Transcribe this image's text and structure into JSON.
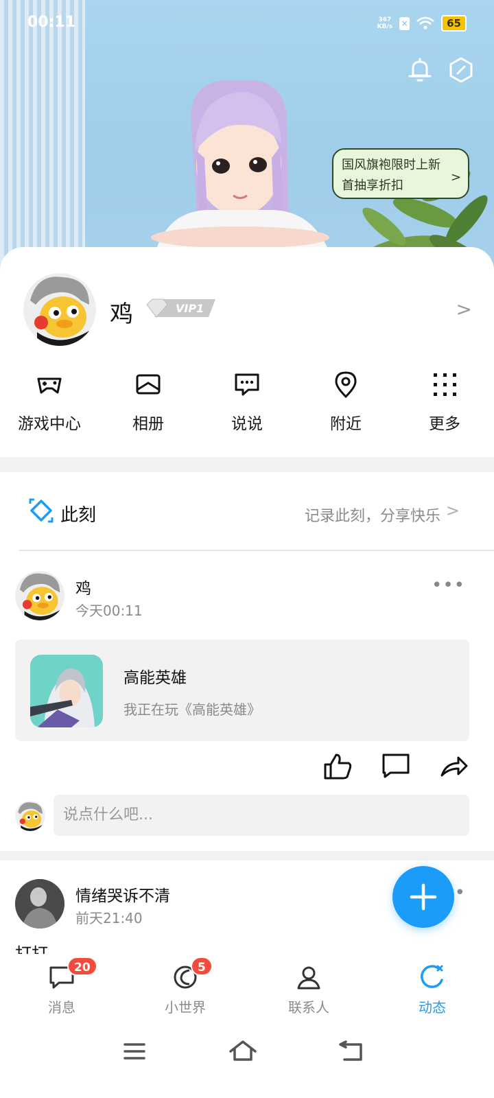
{
  "status_bar": {
    "time": "00:11",
    "net_speed_value": "367",
    "net_speed_unit": "KB/s",
    "sim_glyph": "×",
    "battery": "65"
  },
  "hero": {
    "promo_line1": "国风旗袍限时上新",
    "promo_line2": "首抽享折扣",
    "icons": [
      "bell-icon",
      "settings-hexagon-icon"
    ]
  },
  "profile": {
    "name": "鸡",
    "vip_label": "VIP1"
  },
  "quick_actions": [
    {
      "label": "游戏中心",
      "icon": "gamepad-icon"
    },
    {
      "label": "相册",
      "icon": "album-icon"
    },
    {
      "label": "说说",
      "icon": "message-bubble-icon"
    },
    {
      "label": "附近",
      "icon": "location-pin-icon"
    },
    {
      "label": "更多",
      "icon": "grid-dots-icon"
    }
  ],
  "moment": {
    "title": "此刻",
    "hint": "记录此刻，分享快乐"
  },
  "post": {
    "author": "鸡",
    "time": "今天00:11",
    "more": "•••",
    "game_title": "高能英雄",
    "game_subtitle": "我正在玩《高能英雄》",
    "comment_placeholder": "说点什么吧..."
  },
  "post2": {
    "author": "情绪哭诉不清",
    "time": "前天21:40",
    "more": "••",
    "peek_text": "打打"
  },
  "tabs": [
    {
      "label": "消息",
      "badge": "20",
      "icon": "chat-icon"
    },
    {
      "label": "小世界",
      "badge": "5",
      "icon": "planet-icon"
    },
    {
      "label": "联系人",
      "badge": "",
      "icon": "person-icon"
    },
    {
      "label": "动态",
      "badge": "",
      "icon": "refresh-star-icon",
      "active": true
    }
  ],
  "colors": {
    "accent": "#1a9cf8",
    "badge": "#f24b3c",
    "hero_sky": "#a9d5ef",
    "battery": "#f5c400"
  }
}
